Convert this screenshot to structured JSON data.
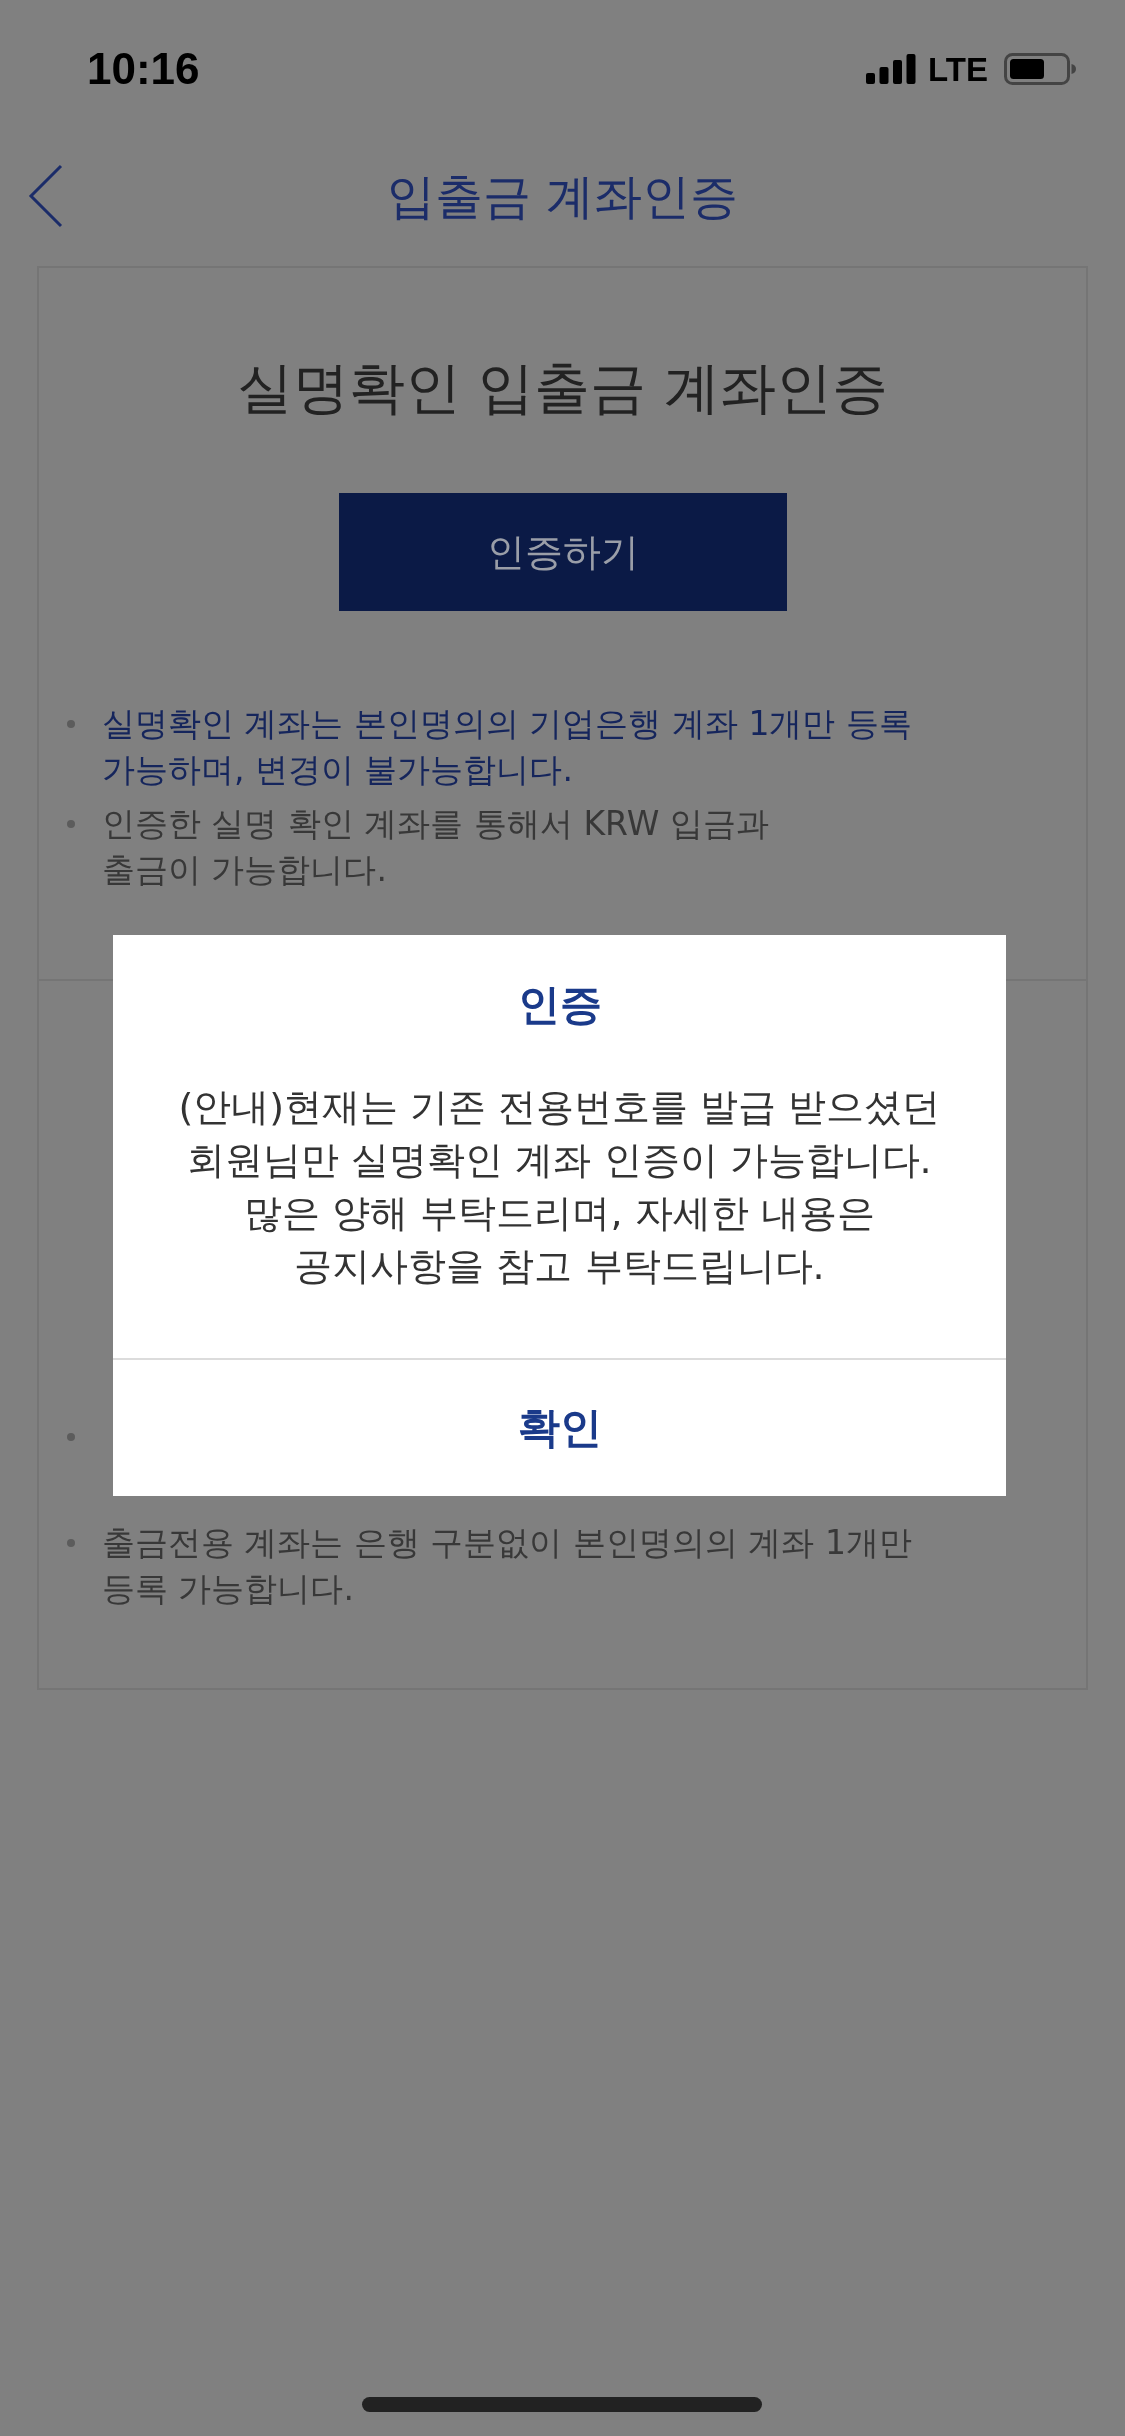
{
  "status_bar": {
    "time": "10:16",
    "network": "LTE"
  },
  "header": {
    "title": "입출금 계좌인증"
  },
  "card": {
    "title": "실명확인 입출금 계좌인증",
    "button": "인증하기",
    "notes": [
      {
        "kind": "highlight",
        "lines": [
          "실명확인 계좌는 본인명의의 기업은행 계좌 1개만 등록",
          "가능하며, 변경이 불가능합니다."
        ]
      },
      {
        "kind": "plain",
        "lines": [
          "인증한 실명 확인 계좌를 통해서 KRW 입금과",
          "출금이 가능합니다."
        ]
      }
    ]
  },
  "lower_section": {
    "notes": [
      {
        "kind": "covered"
      },
      {
        "kind": "plain",
        "lines": [
          "출금전용 계좌는 은행 구분없이 본인명의의 계좌 1개만",
          "등록 가능합니다."
        ]
      }
    ]
  },
  "dialog": {
    "title": "인증",
    "message_lines": [
      "(안내)현재는 기존 전용번호를 발급 받으셨던",
      "회원님만 실명확인 계좌 인증이 가능합니다.",
      "많은 양해 부탁드리며, 자세한 내용은",
      "공지사항을 참고 부탁드립니다."
    ],
    "button": "확인"
  }
}
